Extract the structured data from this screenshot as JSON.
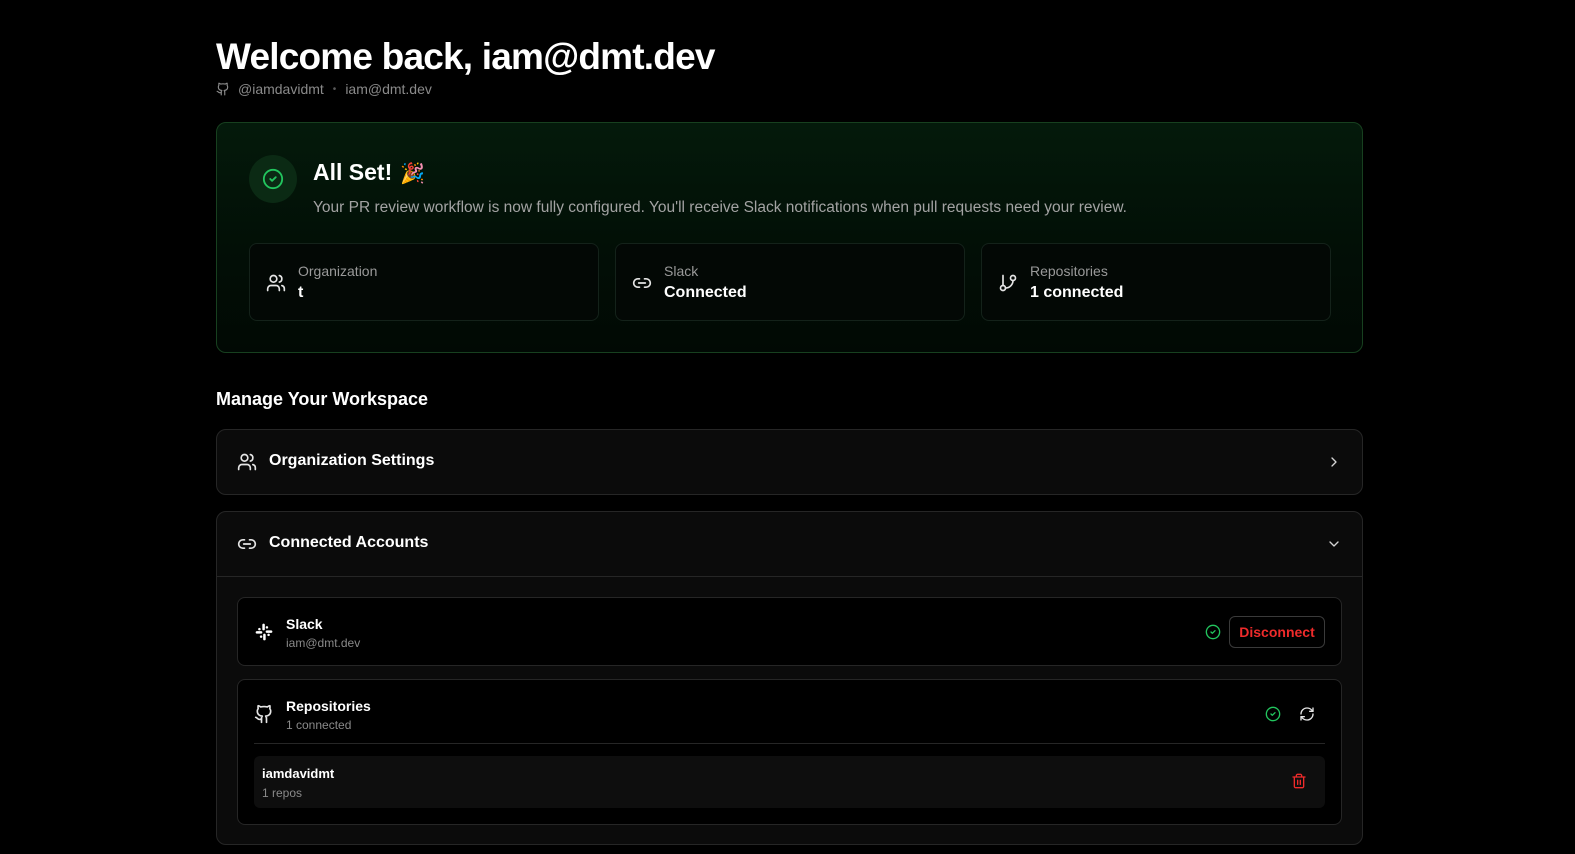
{
  "header": {
    "title": "Welcome back, iam@dmt.dev",
    "username": "@iamdavidmt",
    "separator": "•",
    "email": "iam@dmt.dev"
  },
  "status_card": {
    "title": "All Set!",
    "emoji": "🎉",
    "description": "Your PR review workflow is now fully configured. You'll receive Slack notifications when pull requests need your review.",
    "stats": [
      {
        "icon": "users-icon",
        "label": "Organization",
        "value": "t"
      },
      {
        "icon": "link-icon",
        "label": "Slack",
        "value": "Connected"
      },
      {
        "icon": "git-branch-icon",
        "label": "Repositories",
        "value": "1 connected"
      }
    ]
  },
  "manage": {
    "title": "Manage Your Workspace",
    "organization_settings": {
      "label": "Organization Settings",
      "icon": "users-icon"
    },
    "connected_accounts": {
      "label": "Connected Accounts",
      "icon": "link-icon",
      "slack": {
        "name": "Slack",
        "detail": "iam@dmt.dev",
        "action": "Disconnect"
      },
      "repositories": {
        "name": "Repositories",
        "detail": "1 connected",
        "items": [
          {
            "owner": "iamdavidmt",
            "count": "1 repos"
          }
        ]
      }
    }
  },
  "colors": {
    "success": "#22c55e",
    "danger": "#ef2b2b",
    "background": "#000000"
  }
}
